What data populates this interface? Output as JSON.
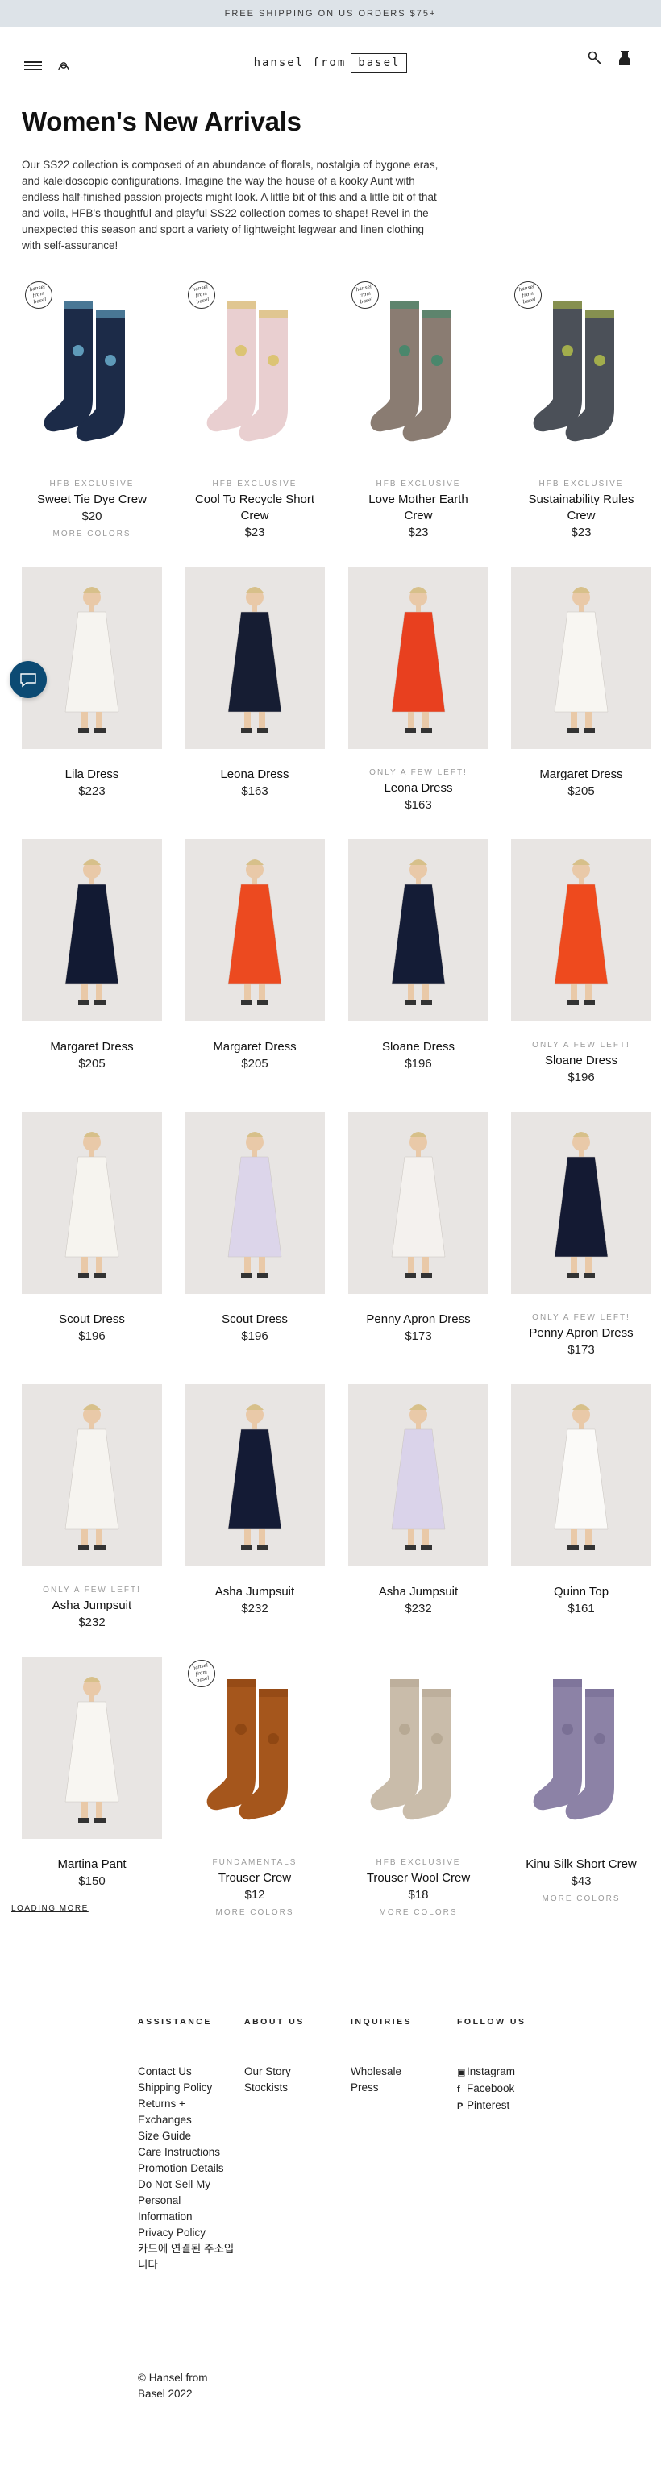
{
  "announcement": "FREE SHIPPING ON US ORDERS $75+",
  "header": {
    "logo_left": "hansel from",
    "logo_right": "basel"
  },
  "page_title": "Women's New Arrivals",
  "intro": "Our SS22 collection is composed of an abundance of florals, nostalgia of bygone eras, and kaleidoscopic configurations. Imagine the way the house of a kooky Aunt with endless half-finished passion projects might look. A little bit of this and a little bit of that and voila, HFB's thoughtful and playful SS22 collection comes to shape! Revel in the unexpected this season and sport a variety of lightweight legwear and linen clothing with self-assurance!",
  "badge_text": "hansel from basel",
  "products": [
    {
      "tag": "HFB EXCLUSIVE",
      "name": "Sweet Tie Dye Crew",
      "price": "$20",
      "colors": "MORE COLORS",
      "kind": "sock",
      "color": "#1c2b48",
      "accent": "#6fb7d6",
      "badge": true
    },
    {
      "tag": "HFB EXCLUSIVE",
      "name": "Cool To Recycle Short Crew",
      "price": "$23",
      "colors": "",
      "kind": "sock",
      "color": "#e9cfd0",
      "accent": "#d8c05c",
      "badge": true
    },
    {
      "tag": "HFB EXCLUSIVE",
      "name": "Love Mother Earth Crew",
      "price": "$23",
      "colors": "",
      "kind": "sock",
      "color": "#8a7c72",
      "accent": "#3a8a6a",
      "badge": true
    },
    {
      "tag": "HFB EXCLUSIVE",
      "name": "Sustainability Rules Crew",
      "price": "$23",
      "colors": "",
      "kind": "sock",
      "color": "#4b5058",
      "accent": "#b8c44a",
      "badge": true
    },
    {
      "tag": "",
      "name": "Lila Dress",
      "price": "$223",
      "colors": "",
      "kind": "model",
      "color": "#f6f4f0"
    },
    {
      "tag": "",
      "name": "Leona Dress",
      "price": "$163",
      "colors": "",
      "kind": "model",
      "color": "#161d33"
    },
    {
      "tag": "ONLY A FEW LEFT!",
      "name": "Leona Dress",
      "price": "$163",
      "colors": "",
      "kind": "model",
      "color": "#e8401f"
    },
    {
      "tag": "",
      "name": "Margaret Dress",
      "price": "$205",
      "colors": "",
      "kind": "model",
      "color": "#f8f6f2"
    },
    {
      "tag": "",
      "name": "Margaret Dress",
      "price": "$205",
      "colors": "",
      "kind": "model",
      "color": "#121a33"
    },
    {
      "tag": "",
      "name": "Margaret Dress",
      "price": "$205",
      "colors": "",
      "kind": "model",
      "color": "#ec4a20"
    },
    {
      "tag": "",
      "name": "Sloane Dress",
      "price": "$196",
      "colors": "",
      "kind": "model",
      "color": "#141c36"
    },
    {
      "tag": "ONLY A FEW LEFT!",
      "name": "Sloane Dress",
      "price": "$196",
      "colors": "",
      "kind": "model",
      "color": "#ee4a1e"
    },
    {
      "tag": "",
      "name": "Scout Dress",
      "price": "$196",
      "colors": "",
      "kind": "model",
      "color": "#f6f4ef"
    },
    {
      "tag": "",
      "name": "Scout Dress",
      "price": "$196",
      "colors": "",
      "kind": "model",
      "color": "#dcd5ea"
    },
    {
      "tag": "",
      "name": "Penny Apron Dress",
      "price": "$173",
      "colors": "",
      "kind": "model",
      "color": "#f4f1ee"
    },
    {
      "tag": "ONLY A FEW LEFT!",
      "name": "Penny Apron Dress",
      "price": "$173",
      "colors": "",
      "kind": "model",
      "color": "#141a33"
    },
    {
      "tag": "ONLY A FEW LEFT!",
      "name": "Asha Jumpsuit",
      "price": "$232",
      "colors": "",
      "kind": "model",
      "color": "#f6f4f0"
    },
    {
      "tag": "",
      "name": "Asha Jumpsuit",
      "price": "$232",
      "colors": "",
      "kind": "model",
      "color": "#141b35"
    },
    {
      "tag": "",
      "name": "Asha Jumpsuit",
      "price": "$232",
      "colors": "",
      "kind": "model",
      "color": "#dad3ea"
    },
    {
      "tag": "",
      "name": "Quinn Top",
      "price": "$161",
      "colors": "",
      "kind": "model",
      "color": "#fbfaf8"
    },
    {
      "tag": "",
      "name": "Martina Pant",
      "price": "$150",
      "colors": "",
      "kind": "model",
      "color": "#f8f6f2"
    },
    {
      "tag": "FUNDAMENTALS",
      "name": "Trouser Crew",
      "price": "$12",
      "colors": "MORE COLORS",
      "kind": "sock",
      "color": "#a5561c",
      "accent": "#8a4412",
      "badge": true
    },
    {
      "tag": "HFB EXCLUSIVE",
      "name": "Trouser Wool Crew",
      "price": "$18",
      "colors": "MORE COLORS",
      "kind": "sock",
      "color": "#c9bcaa",
      "accent": "#b3a48f"
    },
    {
      "tag": "",
      "name": "Kinu Silk Short Crew",
      "price": "$43",
      "colors": "MORE COLORS",
      "kind": "sock",
      "color": "#8c82a6",
      "accent": "#756b91"
    }
  ],
  "loading_more": "LOADING MORE",
  "footer": {
    "assistance": {
      "title": "ASSISTANCE",
      "links": [
        "Contact Us",
        "Shipping Policy",
        "Returns + Exchanges",
        "Size Guide",
        "Care Instructions",
        "Promotion Details",
        "Do Not Sell My Personal Information",
        "Privacy Policy",
        "카드에 연결된 주소입니다"
      ]
    },
    "about": {
      "title": "ABOUT US",
      "links": [
        "Our Story",
        "Stockists"
      ]
    },
    "inquiries": {
      "title": "INQUIRIES",
      "links": [
        "Wholesale",
        "Press"
      ]
    },
    "follow": {
      "title": "FOLLOW US",
      "links": [
        {
          "icon": "instagram-icon",
          "label": "Instagram"
        },
        {
          "icon": "facebook-icon",
          "label": "Facebook"
        },
        {
          "icon": "pinterest-icon",
          "label": "Pinterest"
        }
      ]
    },
    "copyright": "© Hansel from Basel 2022"
  }
}
